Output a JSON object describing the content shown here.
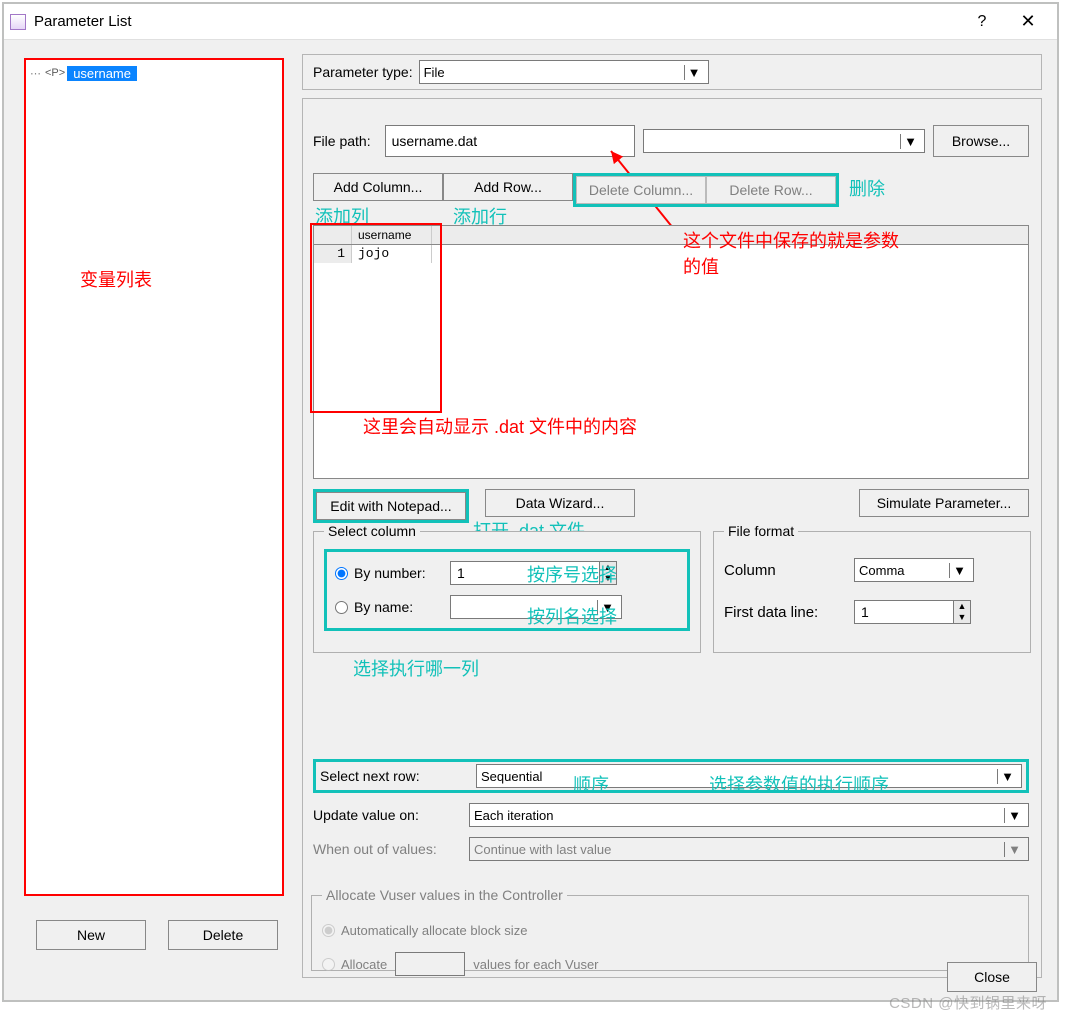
{
  "title": "Parameter List",
  "tree": {
    "item0": "username"
  },
  "buttons": {
    "new": "New",
    "delete": "Delete",
    "browse": "Browse...",
    "addColumn": "Add Column...",
    "addRow": "Add Row...",
    "deleteColumn": "Delete Column...",
    "deleteRow": "Delete Row...",
    "editNotepad": "Edit with Notepad...",
    "dataWizard": "Data Wizard...",
    "simulate": "Simulate Parameter...",
    "close": "Close"
  },
  "labels": {
    "paramType": "Parameter type:",
    "filePath": "File path:",
    "selectColumn": "Select column",
    "byNumber": "By number:",
    "byName": "By name:",
    "fileFormat": "File format",
    "column": "Column",
    "firstDataLine": "First data line:",
    "selectNextRow": "Select next row:",
    "updateValue": "Update value on:",
    "whenOut": "When out of values:",
    "allocateGroup": "Allocate Vuser values in the Controller",
    "allocAuto": "Automatically allocate block size",
    "allocManual": "Allocate",
    "allocSuffix": "values for each Vuser"
  },
  "values": {
    "paramType": "File",
    "filePath": "username.dat",
    "byNumber": "1",
    "columnDelim": "Comma",
    "firstDataLine": "1",
    "selectNextRow": "Sequential",
    "updateValue": "Each iteration",
    "whenOut": "Continue with last value"
  },
  "grid": {
    "header": "username",
    "rows": [
      {
        "n": "1",
        "v": "jojo"
      }
    ]
  },
  "annotations": {
    "varList": "变量列表",
    "addCol": "添加列",
    "addRow": "添加行",
    "deleteAnn": "删除",
    "fileDesc1": "这个文件中保存的就是参数",
    "fileDesc2": "的值",
    "datContent": "这里会自动显示 .dat 文件中的内容",
    "openDat": "打开 .dat 文件",
    "byNumAnn": "按序号选择",
    "byNameAnn": "按列名选择",
    "selColAnn": "选择执行哪一列",
    "seqAnn": "顺序",
    "rowOrderAnn": "选择参数值的执行顺序"
  },
  "watermark": "CSDN @快到锅里来呀"
}
